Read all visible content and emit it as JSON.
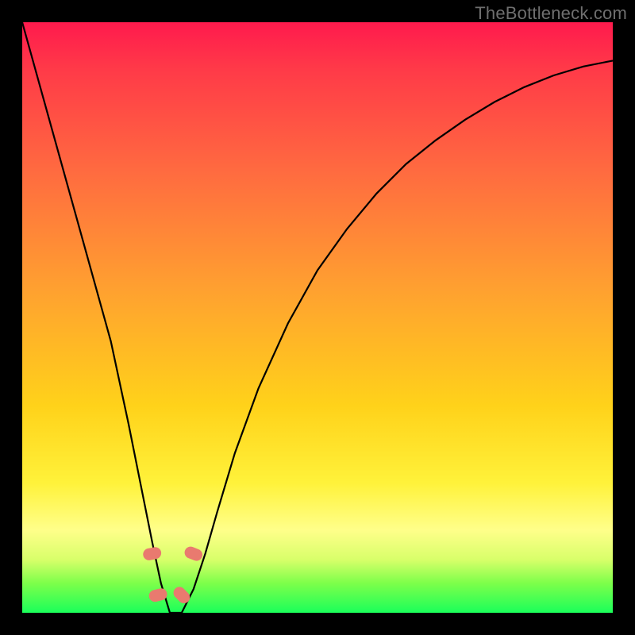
{
  "watermark": "TheBottleneck.com",
  "colors": {
    "frame_background": "#000000",
    "gradient_top": "#ff1a4d",
    "gradient_bottom": "#1aff5a",
    "curve_stroke": "#000000",
    "marker_fill": "#e97a6f",
    "watermark_text": "#6f6f6f"
  },
  "chart_data": {
    "type": "line",
    "title": "",
    "xlabel": "",
    "ylabel": "",
    "xlim": [
      0,
      100
    ],
    "ylim": [
      0,
      100
    ],
    "grid": false,
    "legend": false,
    "note": "No numeric axes or tick labels are rendered in the image; values below are pixel-relative readings (0–100 each axis) of the single black curve, with y=100 at top and y=0 at bottom.",
    "series": [
      {
        "name": "curve",
        "x": [
          0,
          5,
          10,
          15,
          18,
          20,
          22,
          23.5,
          25,
          27,
          29,
          31,
          33,
          36,
          40,
          45,
          50,
          55,
          60,
          65,
          70,
          75,
          80,
          85,
          90,
          95,
          100
        ],
        "y": [
          100,
          82,
          64,
          46,
          32,
          22,
          12,
          5,
          0,
          0,
          4,
          10,
          17,
          27,
          38,
          49,
          58,
          65,
          71,
          76,
          80,
          83.5,
          86.5,
          89,
          91,
          92.5,
          93.5
        ]
      }
    ],
    "markers": [
      {
        "x": 22.0,
        "y": 10.0
      },
      {
        "x": 23.0,
        "y": 3.0
      },
      {
        "x": 27.0,
        "y": 3.0
      },
      {
        "x": 29.0,
        "y": 10.0
      }
    ]
  }
}
